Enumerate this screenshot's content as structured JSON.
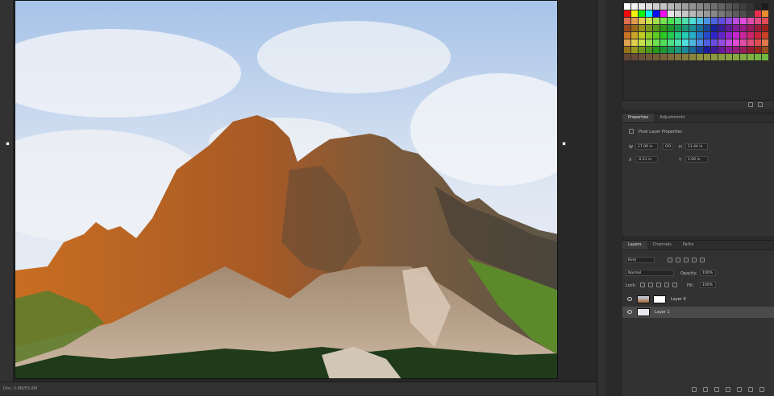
{
  "document": {
    "status": "Doc: 5.6M/55.6M",
    "image_alt": "Sunlit rocky mountain peak under cloudy sky"
  },
  "properties_panel": {
    "tabs": [
      "Properties",
      "Adjustments"
    ],
    "active_tab": "Properties",
    "kind": "Pixel Layer Properties",
    "w": "17.06 in",
    "h": "11.44 in",
    "link": "GO",
    "x": "-0.21 in",
    "y": "1.00 in"
  },
  "layers_panel": {
    "tabs": [
      "Layers",
      "Channels",
      "Paths"
    ],
    "active_tab": "Layers",
    "kind_filter": "Kind",
    "blend_mode": "Normal",
    "opacity_label": "Opacity:",
    "opacity_value": "100%",
    "lock_label": "Lock:",
    "fill_label": "Fill:",
    "fill_value": "100%",
    "layers": [
      {
        "name": "Layer 0",
        "visible": true,
        "selected": false,
        "has_mask": true
      },
      {
        "name": "Layer 1",
        "visible": true,
        "selected": true,
        "has_mask": false
      }
    ]
  },
  "colors": {
    "accent": "#5a5a5a",
    "selected_layer": "#4a4a4a"
  }
}
